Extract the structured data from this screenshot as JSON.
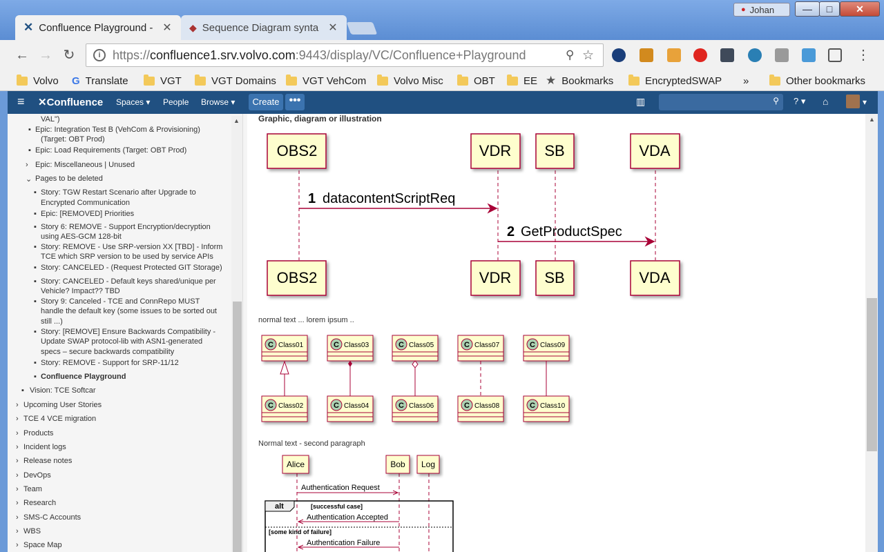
{
  "window": {
    "user": "Johan",
    "min": "—",
    "max": "□",
    "close": "✕"
  },
  "tabs": [
    {
      "label": "Confluence Playground -",
      "icon": "confluence-icon",
      "active": true
    },
    {
      "label": "Sequence Diagram synta",
      "icon": "plantuml-icon",
      "active": false
    }
  ],
  "toolbar": {
    "back": "←",
    "forward": "→",
    "reload": "↻",
    "info": "i",
    "menu": "⋮"
  },
  "url": {
    "prefix": "https://",
    "host": "confluence1.srv.volvo.com",
    "rest": ":9443/display/VC/Confluence+Playground"
  },
  "bookmarks": [
    "Volvo",
    "Translate",
    "VGT",
    "VGT Domains",
    "VGT VehCom",
    "Volvo Misc",
    "OBT",
    "EE",
    "Bookmarks",
    "EncryptedSWAP",
    "»",
    "Other bookmarks"
  ],
  "confluence": {
    "menu": "≡",
    "logo": "Confluence",
    "spaces": "Spaces ▾",
    "people": "People",
    "browse": "Browse ▾",
    "create": "Create",
    "more": "•••",
    "help": "? ▾",
    "notif": "▾"
  },
  "sidebar": {
    "items": [
      "VAL\")",
      "Epic: Integration Test B (VehCom & Provisioning)",
      "(Target: OBT Prod)",
      "Epic: Load Requirements (Target: OBT Prod)",
      "Epic: Miscellaneous | Unused",
      "Pages to be deleted",
      "Story: TGW Restart Scenario after Upgrade to",
      "Encrypted Communication",
      "Epic: [REMOVED] Priorities",
      "Story 6: REMOVE - Support Encryption/decryption",
      "using AES-GCM 128-bit",
      "Story: REMOVE - Use SRP-version XX [TBD] - Inform",
      "TCE which SRP version to be used by service APIs",
      "Story: CANCELED - (Request Protected GIT Storage)",
      "Story: CANCELED - Default keys shared/unique per",
      "Vehicle? Impact?? TBD",
      "Story 9: Canceled - TCE and ConnRepo MUST",
      "handle the default key (some issues to be sorted out",
      "still ...)",
      "Story: [REMOVE] Ensure Backwards Compatibility -",
      "Update SWAP protocol-lib with ASN1-generated",
      "specs – secure backwards compatibility",
      "Story: REMOVE - Support for SRP-11/12",
      "Confluence Playground",
      "Vision: TCE Softcar",
      "Upcoming User Stories",
      "TCE 4 VCE migration",
      "Products",
      "Incident logs",
      "Release notes",
      "DevOps",
      "Team",
      "Research",
      "SMS-C Accounts",
      "WBS",
      "Space Map"
    ]
  },
  "main": {
    "heading": "Graphic, diagram or illustration",
    "para1": "normal text ... lorem ipsum ..",
    "para2": "Normal text - second paragraph",
    "seq1": {
      "participants": [
        "OBS2",
        "VDR",
        "SB",
        "VDA"
      ],
      "msg1_num": "1",
      "msg1": "datacontentScriptReq",
      "msg2_num": "2",
      "msg2": "GetProductSpec"
    },
    "classes": [
      "Class01",
      "Class02",
      "Class03",
      "Class04",
      "Class05",
      "Class06",
      "Class07",
      "Class08",
      "Class09",
      "Class10"
    ],
    "class_glyph": "C",
    "seq2": {
      "participants": [
        "Alice",
        "Bob",
        "Log"
      ],
      "req": "Authentication Request",
      "alt": "alt",
      "guard1": "[successful case]",
      "accepted": "Authentication Accepted",
      "guard2": "[some kind of failure]",
      "failure": "Authentication Failure"
    }
  },
  "colors": {
    "titlebar": "#6b9ad8",
    "confluence_header": "#205081",
    "create": "#3b73af",
    "uml_fill": "#fefece",
    "uml_border": "#a80036"
  }
}
